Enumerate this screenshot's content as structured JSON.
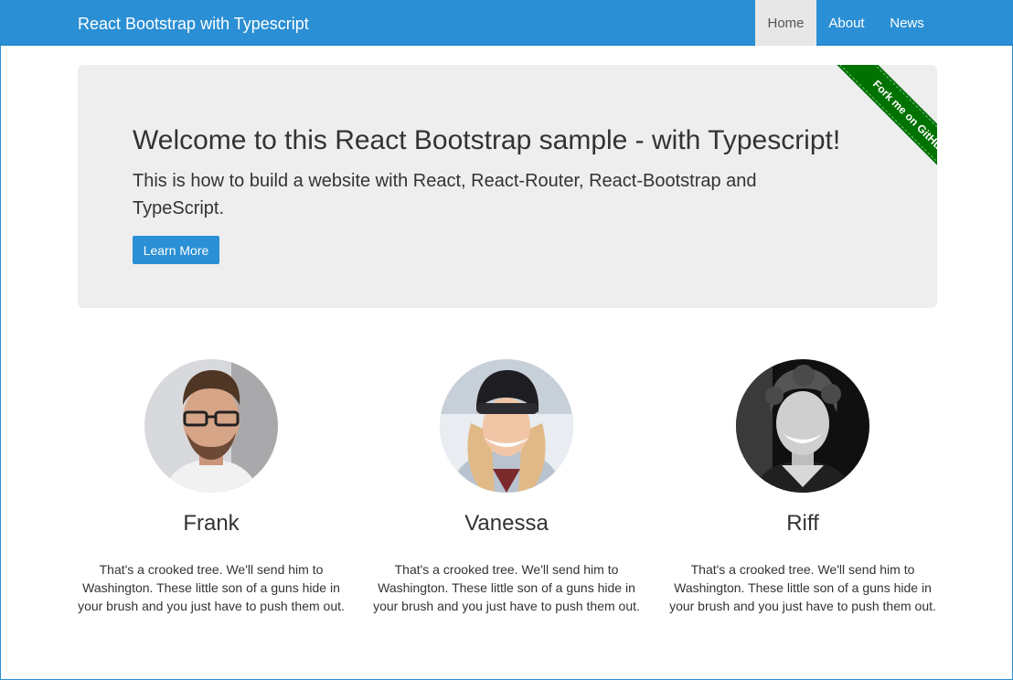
{
  "navbar": {
    "brand": "React Bootstrap with Typescript",
    "items": [
      {
        "label": "Home",
        "active": true
      },
      {
        "label": "About",
        "active": false
      },
      {
        "label": "News",
        "active": false
      }
    ]
  },
  "jumbotron": {
    "title": "Welcome to this React Bootstrap sample - with Typescript!",
    "lead": "This is how to build a website with React, React-Router, React-Bootstrap and TypeScript.",
    "button_label": "Learn More",
    "ribbon_label": "Fork me on GitHub"
  },
  "people": [
    {
      "name": "Frank",
      "description": "That's a crooked tree. We'll send him to Washington. These little son of a guns hide in your brush and you just have to push them out."
    },
    {
      "name": "Vanessa",
      "description": "That's a crooked tree. We'll send him to Washington. These little son of a guns hide in your brush and you just have to push them out."
    },
    {
      "name": "Riff",
      "description": "That's a crooked tree. We'll send him to Washington. These little son of a guns hide in your brush and you just have to push them out."
    }
  ],
  "colors": {
    "primary": "#2a8fd4",
    "jumbotron_bg": "#eeeeee",
    "ribbon": "#007200",
    "nav_active_bg": "#e7e7e7"
  }
}
